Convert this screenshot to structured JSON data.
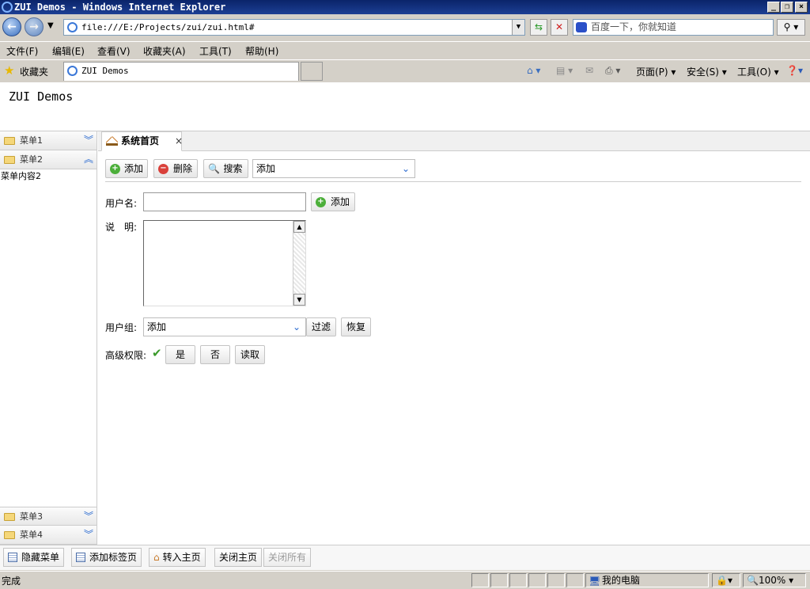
{
  "window": {
    "title": "ZUI Demos - Windows Internet Explorer"
  },
  "address": {
    "url": "file:///E:/Projects/zui/zui.html#",
    "search_placeholder": "百度一下，你就知道"
  },
  "menu": [
    "文件(F)",
    "编辑(E)",
    "查看(V)",
    "收藏夹(A)",
    "工具(T)",
    "帮助(H)"
  ],
  "favbar": {
    "favorites": "收藏夹",
    "tab_title": "ZUI Demos",
    "page": "页面(P)",
    "safety": "安全(S)",
    "tools": "工具(O)"
  },
  "app": {
    "title": "ZUI Demos"
  },
  "sidebar": {
    "items": [
      {
        "label": "菜单1",
        "expanded": false
      },
      {
        "label": "菜单2",
        "expanded": true,
        "content": "菜单内容2"
      },
      {
        "label": "菜单3",
        "expanded": false
      },
      {
        "label": "菜单4",
        "expanded": false
      }
    ]
  },
  "tabs": [
    {
      "label": "系统首页",
      "close": "×"
    }
  ],
  "toolbar": {
    "add": "添加",
    "delete": "删除",
    "search": "搜索",
    "select_value": "添加"
  },
  "form": {
    "username_label": "用户名:",
    "username_value": "",
    "add_button": "添加",
    "desc_label": "说　明:",
    "desc_value": "",
    "group_label": "用户组:",
    "group_value": "添加",
    "filter_button": "过滤",
    "reset_button": "恢复",
    "perm_label": "高级权限:",
    "yes_button": "是",
    "no_button": "否",
    "read_button": "读取"
  },
  "footer": {
    "hide_menu": "隐藏菜单",
    "add_tab": "添加标签页",
    "to_home": "转入主页",
    "close_home": "关闭主页",
    "close_all": "关闭所有"
  },
  "status": {
    "text": "完成",
    "zone": "我的电脑",
    "zoom": "100%"
  }
}
